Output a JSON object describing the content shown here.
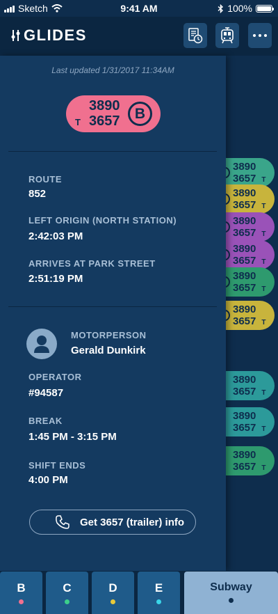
{
  "status_bar": {
    "carrier": "Sketch",
    "time": "9:41 AM",
    "battery": "100%"
  },
  "header": {
    "app_name": "GLIDES"
  },
  "panel": {
    "last_updated": "Last updated 1/31/2017 11:34AM",
    "badge": {
      "car1": "3890",
      "car2": "3657",
      "trailer_mark": "T",
      "route_letter": "B",
      "color": "#f0708f"
    },
    "route_label": "ROUTE",
    "route_value": "852",
    "left_origin_label": "LEFT ORIGIN (NORTH STATION)",
    "left_origin_value": "2:42:03 PM",
    "arrives_label": "ARRIVES AT PARK STREET",
    "arrives_value": "2:51:19 PM",
    "motorperson_label": "MOTORPERSON",
    "motorperson_value": "Gerald Dunkirk",
    "operator_label": "OPERATOR",
    "operator_value": "#94587",
    "break_label": "BREAK",
    "break_value": "1:45 PM - 3:15 PM",
    "shift_label": "SHIFT ENDS",
    "shift_value": "4:00 PM",
    "info_button": "Get 3657 (trailer) info"
  },
  "background_trains": [
    {
      "car1": "3890",
      "car2": "3657",
      "mark": "T",
      "color": "#3aa58a"
    },
    {
      "car1": "3890",
      "car2": "3657",
      "mark": "T",
      "color": "#c8b43c"
    },
    {
      "car1": "3890",
      "car2": "3657",
      "mark": "T",
      "color": "#9a52b8"
    },
    {
      "car1": "3890",
      "car2": "3657",
      "mark": "T",
      "color": "#9a52b8"
    },
    {
      "car1": "3890",
      "car2": "3657",
      "mark": "T",
      "color": "#2e9a6e"
    },
    {
      "car1": "3890",
      "car2": "3657",
      "mark": "T",
      "color": "#c8b43c"
    },
    {
      "car1": "3890",
      "car2": "3657",
      "mark": "T",
      "color": "#2c9a9a"
    },
    {
      "car1": "3890",
      "car2": "3657",
      "mark": "T",
      "color": "#2c9a9a"
    },
    {
      "car1": "3890",
      "car2": "3657",
      "mark": "T",
      "color": "#2e9a6e"
    }
  ],
  "tabs": [
    {
      "label": "B",
      "dot_color": "#f0708f"
    },
    {
      "label": "C",
      "dot_color": "#3ccf8a"
    },
    {
      "label": "D",
      "dot_color": "#e8c93a"
    },
    {
      "label": "E",
      "dot_color": "#3ad6e8"
    },
    {
      "label": "Subway",
      "dot_color": "#0e2d4d"
    }
  ]
}
